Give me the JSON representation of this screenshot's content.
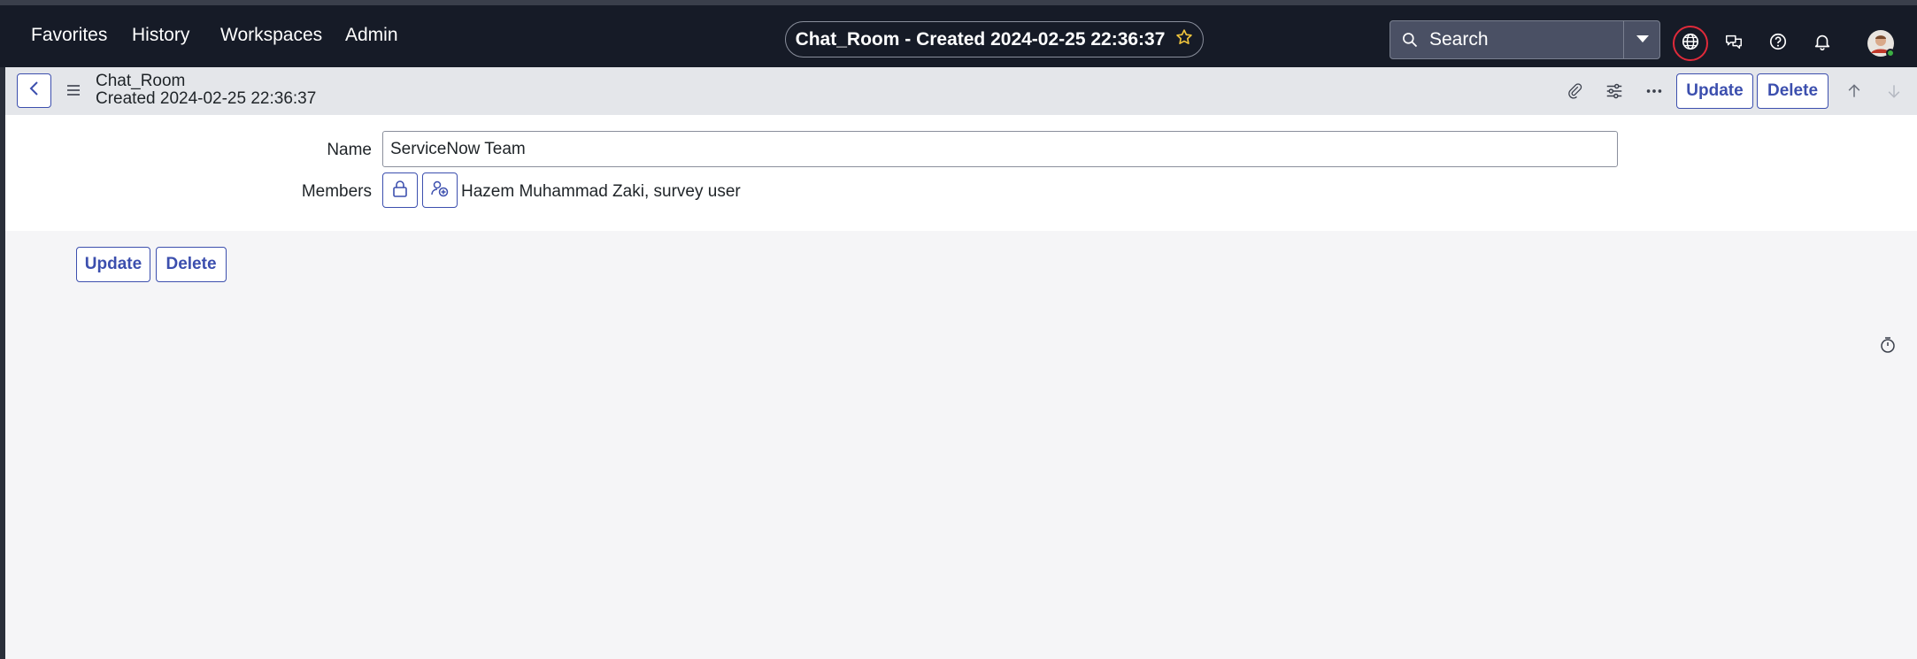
{
  "nav": {
    "items": [
      "Favorites",
      "History",
      "Workspaces",
      "Admin"
    ],
    "title": "Chat_Room - Created 2024-02-25 22:36:37",
    "search_placeholder": "Search",
    "icons": [
      "globe-icon",
      "chat-icon",
      "help-icon",
      "bell-icon"
    ]
  },
  "record": {
    "table": "Chat_Room",
    "created": "Created 2024-02-25 22:36:37",
    "update_label": "Update",
    "delete_label": "Delete"
  },
  "form": {
    "name_label": "Name",
    "name_value": "ServiceNow Team",
    "members_label": "Members",
    "members_value": "Hazem Muhammad Zaki, survey user"
  },
  "footer": {
    "update_label": "Update",
    "delete_label": "Delete"
  },
  "colors": {
    "nav_bg": "#161b27",
    "accent": "#3c4fae",
    "star": "#f0c43c",
    "globe_ring": "#e02a3a"
  }
}
